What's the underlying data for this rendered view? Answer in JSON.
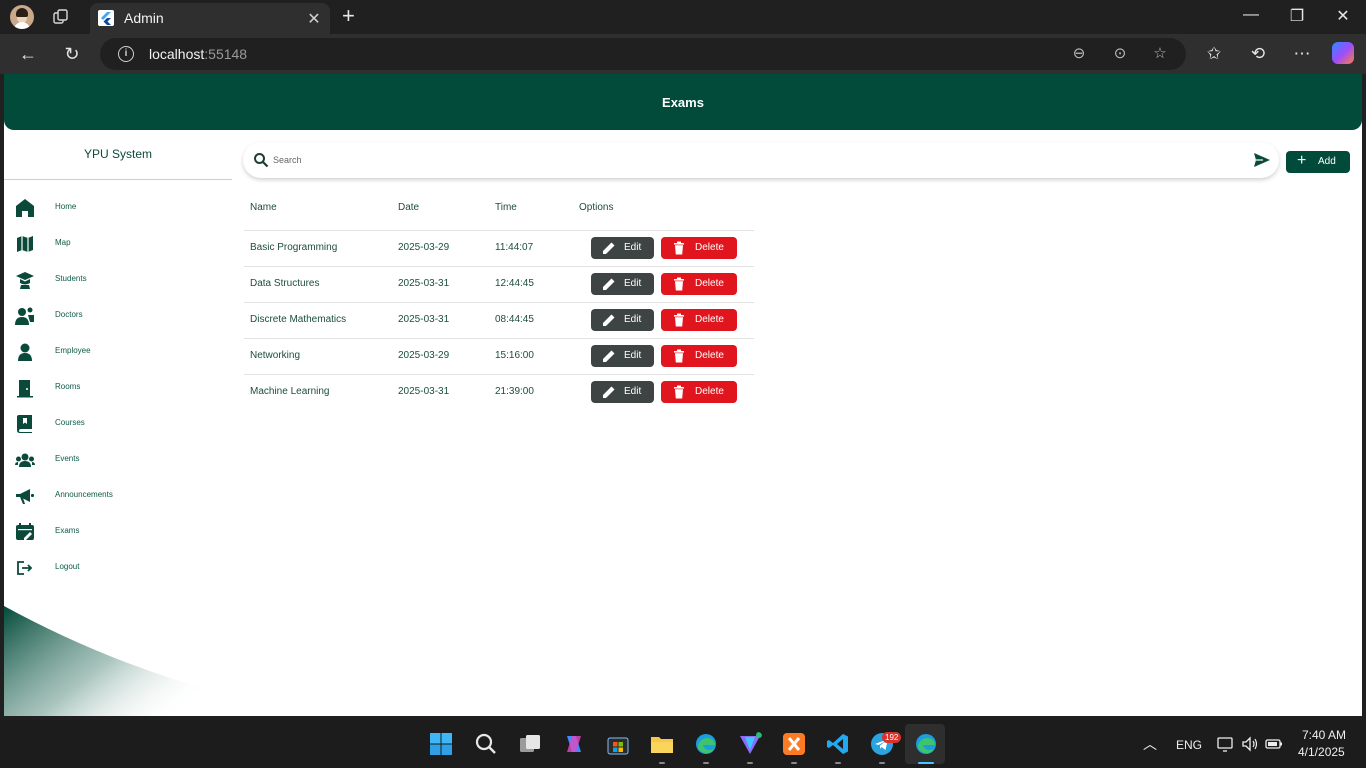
{
  "browser": {
    "tab_title": "Admin",
    "url_host": "localhost",
    "url_port": ":55148"
  },
  "app": {
    "page_title": "Exams",
    "brand": "YPU System",
    "accent": "#024a3a",
    "delete_color": "#e0151e",
    "edit_color": "#3e4444"
  },
  "sidebar": {
    "items": [
      {
        "label": "Home",
        "icon": "home-icon"
      },
      {
        "label": "Map",
        "icon": "map-icon"
      },
      {
        "label": "Students",
        "icon": "graduation-cap-icon"
      },
      {
        "label": "Doctors",
        "icon": "users-icon"
      },
      {
        "label": "Employee",
        "icon": "person-icon"
      },
      {
        "label": "Rooms",
        "icon": "door-icon"
      },
      {
        "label": "Courses",
        "icon": "book-icon"
      },
      {
        "label": "Events",
        "icon": "group-icon"
      },
      {
        "label": "Announcements",
        "icon": "megaphone-icon"
      },
      {
        "label": "Exams",
        "icon": "calendar-edit-icon"
      },
      {
        "label": "Logout",
        "icon": "logout-icon"
      }
    ]
  },
  "search": {
    "placeholder": "Search"
  },
  "toolbar": {
    "add_label": "Add"
  },
  "table": {
    "headers": [
      "Name",
      "Date",
      "Time",
      "Options"
    ],
    "edit_label": "Edit",
    "delete_label": "Delete",
    "rows": [
      {
        "name": "Basic Programming",
        "date": "2025-03-29",
        "time": "11:44:07"
      },
      {
        "name": "Data Structures",
        "date": "2025-03-31",
        "time": "12:44:45"
      },
      {
        "name": "Discrete Mathematics",
        "date": "2025-03-31",
        "time": "08:44:45"
      },
      {
        "name": "Networking",
        "date": "2025-03-29",
        "time": "15:16:00"
      },
      {
        "name": "Machine Learning",
        "date": "2025-03-31",
        "time": "21:39:00"
      }
    ]
  },
  "taskbar": {
    "language": "ENG",
    "time": "7:40 AM",
    "date": "4/1/2025",
    "telegram_badge": "192"
  }
}
